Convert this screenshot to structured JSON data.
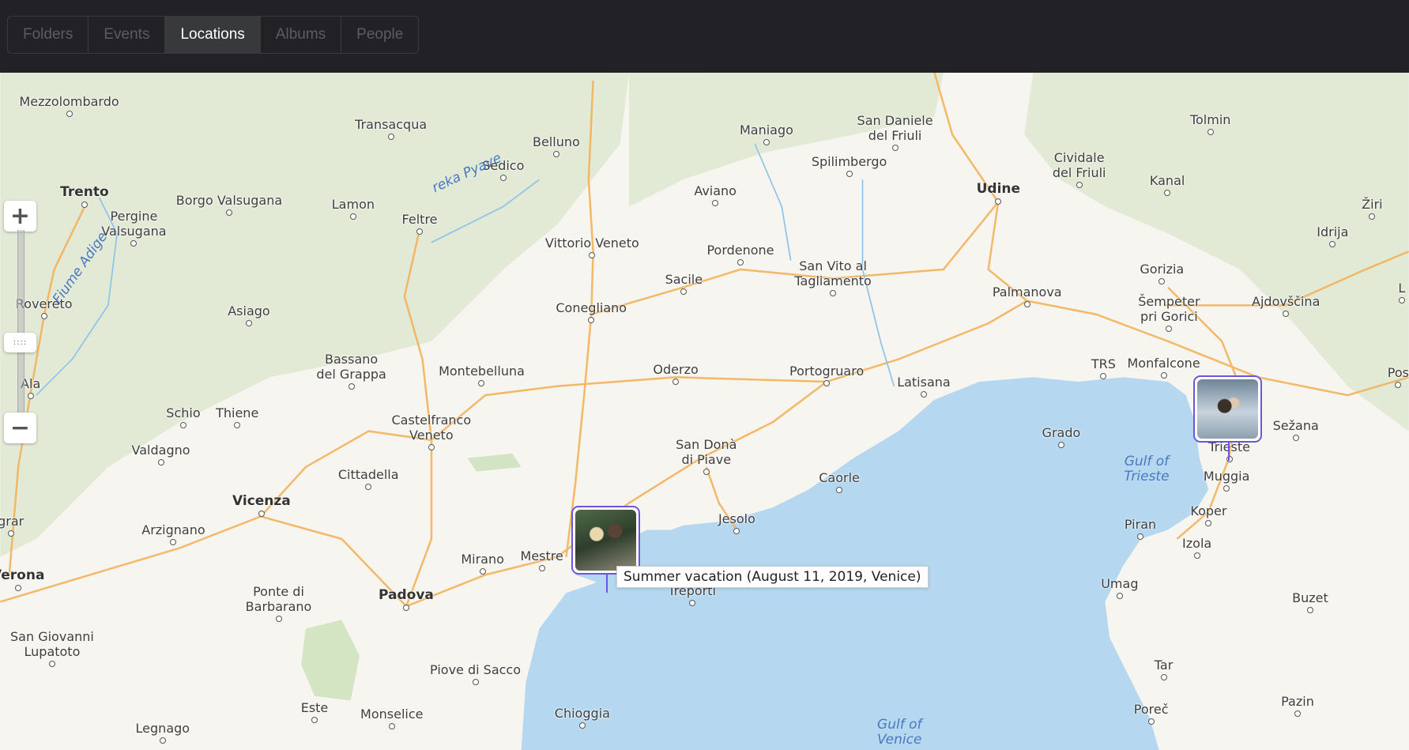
{
  "tabs": [
    {
      "label": "Folders",
      "active": false
    },
    {
      "label": "Events",
      "active": false
    },
    {
      "label": "Locations",
      "active": true
    },
    {
      "label": "Albums",
      "active": false
    },
    {
      "label": "People",
      "active": false
    }
  ],
  "map": {
    "zoom_in_label": "+",
    "zoom_out_label": "−",
    "zoom_handle_label": "::::",
    "colors": {
      "land": "#f7f5ef",
      "water": "#b5d8f0",
      "forest": "#dfe9d3",
      "road": "#f3b25a",
      "marker_border": "#6a55e0"
    },
    "places": [
      "Mezzolombardo",
      "Transacqua",
      "Belluno",
      "Sedico",
      "Maniago",
      "San Daniele\ndel Friuli",
      "Spilimbergo",
      "Udine",
      "Tolmin",
      "Cividale\ndel Friuli",
      "Kanal",
      "Žiri",
      "Idrija",
      "Trento",
      "Pergine\nValsugana",
      "Borgo Valsugana",
      "Lamon",
      "Feltre",
      "Aviano",
      "Vittorio Veneto",
      "Pordenone",
      "Sacile",
      "San Vito al\nTagliamento",
      "Gorizia",
      "Šempeter\npri Gorici",
      "Ajdovščina",
      "Palmanova",
      "Rovereto",
      "Asiago",
      "Conegliano",
      "TRS",
      "Monfalcone",
      "Ala",
      "Bassano\ndel Grappa",
      "Montebelluna",
      "Oderzo",
      "Portogruaro",
      "Latisana",
      "Schio",
      "Thiene",
      "Castelfranco\nVeneto",
      "Sežana",
      "Grado",
      "Valdagno",
      "San Donà\ndi Piave",
      "Gulf of\nTrieste",
      "Cittadella",
      "Caorle",
      "Trieste",
      "Muggia",
      "Vicenza",
      "Koper",
      "Jesolo",
      "Arzignano",
      "Piran",
      "Izola",
      "Mirano",
      "Mestre",
      "Verona",
      "Treporti",
      "Umag",
      "Ponte di\nBarbarano",
      "Padova",
      "Buzet",
      "San Giovanni\nLupatoto",
      "Piove di Sacco",
      "Tar",
      "Este",
      "Monselice",
      "Chioggia",
      "Poreč",
      "Pazin",
      "Legnago",
      "Gulf of\nVenice",
      "Fiume Adige",
      "reka Pyave",
      "grar",
      "Pos",
      "L"
    ],
    "markers": [
      {
        "place": "Venice",
        "icon": "photo-thumbnail",
        "tooltip": "Summer vacation (August 11, 2019, Venice)"
      },
      {
        "place": "Trieste",
        "icon": "photo-thumbnail"
      }
    ]
  }
}
